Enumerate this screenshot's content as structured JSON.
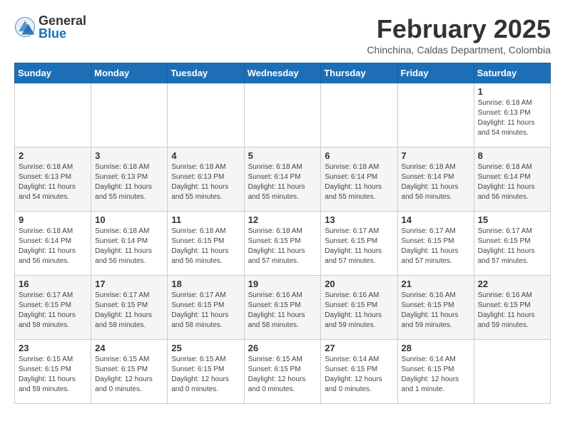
{
  "header": {
    "logo_general": "General",
    "logo_blue": "Blue",
    "month_title": "February 2025",
    "location": "Chinchina, Caldas Department, Colombia"
  },
  "weekdays": [
    "Sunday",
    "Monday",
    "Tuesday",
    "Wednesday",
    "Thursday",
    "Friday",
    "Saturday"
  ],
  "weeks": [
    [
      {
        "day": "",
        "info": ""
      },
      {
        "day": "",
        "info": ""
      },
      {
        "day": "",
        "info": ""
      },
      {
        "day": "",
        "info": ""
      },
      {
        "day": "",
        "info": ""
      },
      {
        "day": "",
        "info": ""
      },
      {
        "day": "1",
        "info": "Sunrise: 6:18 AM\nSunset: 6:13 PM\nDaylight: 11 hours\nand 54 minutes."
      }
    ],
    [
      {
        "day": "2",
        "info": "Sunrise: 6:18 AM\nSunset: 6:13 PM\nDaylight: 11 hours\nand 54 minutes."
      },
      {
        "day": "3",
        "info": "Sunrise: 6:18 AM\nSunset: 6:13 PM\nDaylight: 11 hours\nand 55 minutes."
      },
      {
        "day": "4",
        "info": "Sunrise: 6:18 AM\nSunset: 6:13 PM\nDaylight: 11 hours\nand 55 minutes."
      },
      {
        "day": "5",
        "info": "Sunrise: 6:18 AM\nSunset: 6:14 PM\nDaylight: 11 hours\nand 55 minutes."
      },
      {
        "day": "6",
        "info": "Sunrise: 6:18 AM\nSunset: 6:14 PM\nDaylight: 11 hours\nand 55 minutes."
      },
      {
        "day": "7",
        "info": "Sunrise: 6:18 AM\nSunset: 6:14 PM\nDaylight: 11 hours\nand 56 minutes."
      },
      {
        "day": "8",
        "info": "Sunrise: 6:18 AM\nSunset: 6:14 PM\nDaylight: 11 hours\nand 56 minutes."
      }
    ],
    [
      {
        "day": "9",
        "info": "Sunrise: 6:18 AM\nSunset: 6:14 PM\nDaylight: 11 hours\nand 56 minutes."
      },
      {
        "day": "10",
        "info": "Sunrise: 6:18 AM\nSunset: 6:14 PM\nDaylight: 11 hours\nand 56 minutes."
      },
      {
        "day": "11",
        "info": "Sunrise: 6:18 AM\nSunset: 6:15 PM\nDaylight: 11 hours\nand 56 minutes."
      },
      {
        "day": "12",
        "info": "Sunrise: 6:18 AM\nSunset: 6:15 PM\nDaylight: 11 hours\nand 57 minutes."
      },
      {
        "day": "13",
        "info": "Sunrise: 6:17 AM\nSunset: 6:15 PM\nDaylight: 11 hours\nand 57 minutes."
      },
      {
        "day": "14",
        "info": "Sunrise: 6:17 AM\nSunset: 6:15 PM\nDaylight: 11 hours\nand 57 minutes."
      },
      {
        "day": "15",
        "info": "Sunrise: 6:17 AM\nSunset: 6:15 PM\nDaylight: 11 hours\nand 57 minutes."
      }
    ],
    [
      {
        "day": "16",
        "info": "Sunrise: 6:17 AM\nSunset: 6:15 PM\nDaylight: 11 hours\nand 58 minutes."
      },
      {
        "day": "17",
        "info": "Sunrise: 6:17 AM\nSunset: 6:15 PM\nDaylight: 11 hours\nand 58 minutes."
      },
      {
        "day": "18",
        "info": "Sunrise: 6:17 AM\nSunset: 6:15 PM\nDaylight: 11 hours\nand 58 minutes."
      },
      {
        "day": "19",
        "info": "Sunrise: 6:16 AM\nSunset: 6:15 PM\nDaylight: 11 hours\nand 58 minutes."
      },
      {
        "day": "20",
        "info": "Sunrise: 6:16 AM\nSunset: 6:15 PM\nDaylight: 11 hours\nand 59 minutes."
      },
      {
        "day": "21",
        "info": "Sunrise: 6:16 AM\nSunset: 6:15 PM\nDaylight: 11 hours\nand 59 minutes."
      },
      {
        "day": "22",
        "info": "Sunrise: 6:16 AM\nSunset: 6:15 PM\nDaylight: 11 hours\nand 59 minutes."
      }
    ],
    [
      {
        "day": "23",
        "info": "Sunrise: 6:15 AM\nSunset: 6:15 PM\nDaylight: 11 hours\nand 59 minutes."
      },
      {
        "day": "24",
        "info": "Sunrise: 6:15 AM\nSunset: 6:15 PM\nDaylight: 12 hours\nand 0 minutes."
      },
      {
        "day": "25",
        "info": "Sunrise: 6:15 AM\nSunset: 6:15 PM\nDaylight: 12 hours\nand 0 minutes."
      },
      {
        "day": "26",
        "info": "Sunrise: 6:15 AM\nSunset: 6:15 PM\nDaylight: 12 hours\nand 0 minutes."
      },
      {
        "day": "27",
        "info": "Sunrise: 6:14 AM\nSunset: 6:15 PM\nDaylight: 12 hours\nand 0 minutes."
      },
      {
        "day": "28",
        "info": "Sunrise: 6:14 AM\nSunset: 6:15 PM\nDaylight: 12 hours\nand 1 minute."
      },
      {
        "day": "",
        "info": ""
      }
    ]
  ]
}
